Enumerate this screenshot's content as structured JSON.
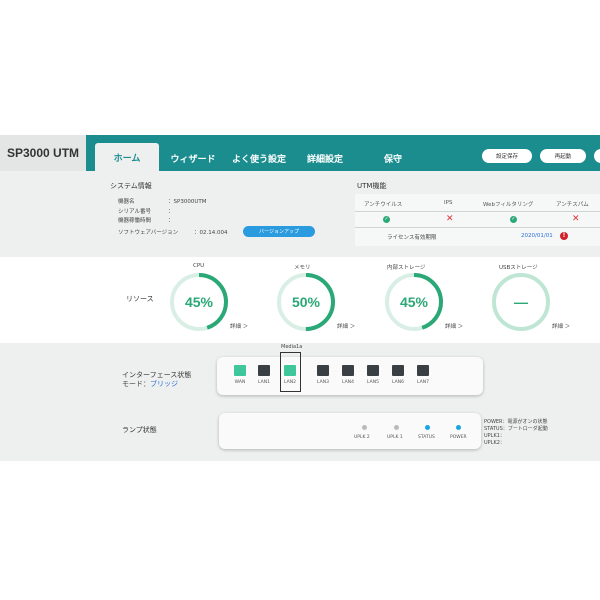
{
  "brand": {
    "title": "SP3000 UTM"
  },
  "tabs": [
    {
      "label": "ホーム",
      "active": true
    },
    {
      "label": "ウィザード"
    },
    {
      "label": "よく使う設定"
    },
    {
      "label": "詳細設定"
    },
    {
      "label": "保守"
    }
  ],
  "header_buttons": [
    {
      "label": "設定保存"
    },
    {
      "label": "再起動"
    }
  ],
  "system_info": {
    "title": "システム情報",
    "rows": [
      {
        "label": "機器名",
        "value": "SP3000UTM"
      },
      {
        "label": "シリアル番号",
        "value": ""
      },
      {
        "label": "機器稼働時間",
        "value": ""
      },
      {
        "label": "ソフトウェアバージョン",
        "value": "02.14.004"
      }
    ],
    "version_button": "バージョンアップ"
  },
  "utm": {
    "title": "UTM機能",
    "headers": [
      "アンチウイルス",
      "IPS",
      "Webフィルタリング",
      "アンチスパム"
    ],
    "status": [
      "check",
      "cross",
      "check",
      "cross"
    ],
    "license_label": "ライセンス有効期限",
    "license_value": "2020/01/01",
    "warn_symbol": "!"
  },
  "resource": {
    "title": "リソース",
    "gauges": [
      {
        "name": "CPU",
        "value_text": "45%",
        "fraction": 0.45,
        "detail": "詳細"
      },
      {
        "name": "メモリ",
        "value_text": "50%",
        "fraction": 0.5,
        "detail": "詳細"
      },
      {
        "name": "内部ストレージ",
        "value_text": "45%",
        "fraction": 0.45,
        "detail": "詳細"
      },
      {
        "name": "USBストレージ",
        "value_text": "—",
        "fraction": 0,
        "detail": "詳細"
      }
    ]
  },
  "interface": {
    "title": "インターフェース状態",
    "mode_label": "モード：",
    "mode_value": "ブリッジ",
    "highlight_label": "Media1a",
    "ports": [
      {
        "label": "WAN",
        "active": true
      },
      {
        "label": "LAN1",
        "active": false
      },
      {
        "label": "LAN2",
        "active": true
      },
      {
        "label": "LAN3",
        "active": false
      },
      {
        "label": "LAN4",
        "active": false
      },
      {
        "label": "LAN5",
        "active": false
      },
      {
        "label": "LAN6",
        "active": false
      },
      {
        "label": "LAN7",
        "active": false
      }
    ]
  },
  "lamp": {
    "title": "ランプ状態",
    "lamps": [
      {
        "label": "UPLK 2",
        "color": "#b8bcbc"
      },
      {
        "label": "UPLK 1",
        "color": "#b8bcbc"
      },
      {
        "label": "STATUS",
        "color": "#19a5e6"
      },
      {
        "label": "POWER",
        "color": "#19a5e6"
      }
    ],
    "info": [
      {
        "label": "POWER",
        "value": "電源がオンの状態"
      },
      {
        "label": "STATUS",
        "value": "ブートローダ起動"
      },
      {
        "label": "UPLK1",
        "value": ""
      },
      {
        "label": "UPLK2",
        "value": ""
      }
    ]
  },
  "colors": {
    "accent": "#1b8d8f",
    "gauge": "#2aa876",
    "link": "#2b9be0",
    "error": "#e03030"
  }
}
